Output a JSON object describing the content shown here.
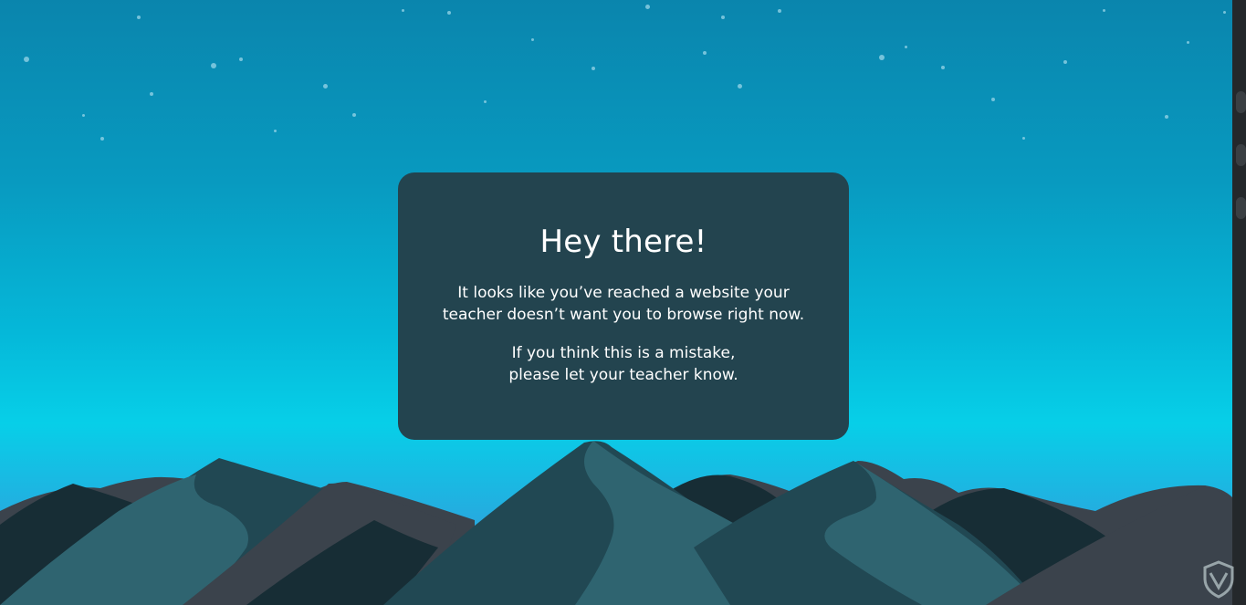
{
  "card": {
    "title": "Hey there!",
    "message_line_1": "It looks like you’ve reached a website your",
    "message_line_2": "teacher doesn’t want you to browse right now.",
    "mistake_line_1": "If you think this is a mistake,",
    "mistake_line_2": "please let your teacher know."
  },
  "colors": {
    "card_background": "#23444f",
    "sky_top": "#0a85ad",
    "sky_mid": "#07cfe8",
    "mountain_dark": "#172d35",
    "mountain_gray": "#3b434c",
    "mountain_teal": "#2f6470",
    "mountain_mid": "#214853"
  },
  "icons": {
    "brand_logo": "shield-logo-icon"
  }
}
